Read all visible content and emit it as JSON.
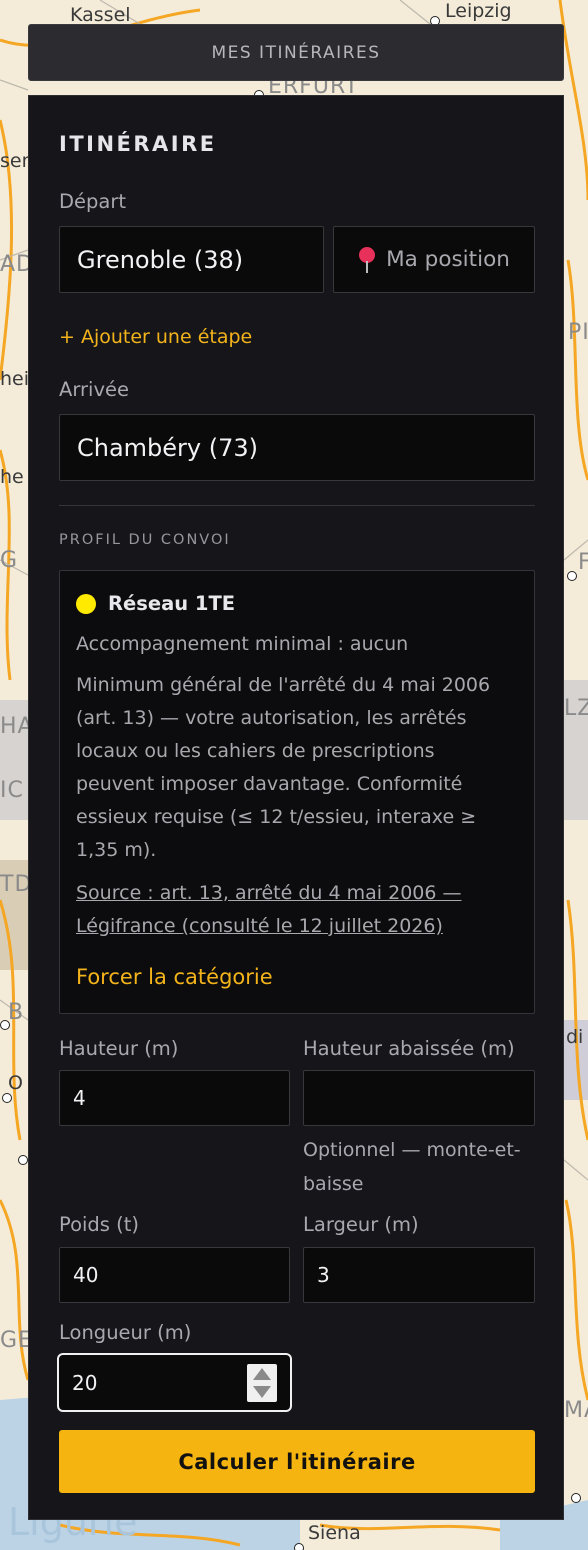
{
  "map": {
    "labels": {
      "kassel": "Kassel",
      "leipzig": "Leipzig",
      "erfurt": "ERFURT",
      "sen": "sen",
      "adi": "ADI",
      "pi": "PI",
      "hei": "hei",
      "he": "he",
      "g": "G",
      "f": "F",
      "ha": "HA",
      "lz": "LZ",
      "ic": "IC",
      "td": "TD",
      "b": "B",
      "di": "di",
      "o": "O",
      "ge": "GE",
      "ma": "MA",
      "ligurie": "Ligurie",
      "siena": "Siena"
    }
  },
  "topbar": {
    "label": "MES ITINÉRAIRES"
  },
  "panel": {
    "title": "ITINÉRAIRE",
    "depart": {
      "label": "Départ",
      "value": "Grenoble (38)"
    },
    "position_button": {
      "label": "Ma position",
      "icon": "map-pin-icon",
      "pin_color": "#e8315a"
    },
    "add_step": "+ Ajouter une étape",
    "arrivee": {
      "label": "Arrivée",
      "value": "Chambéry (73)"
    },
    "section_title": "PROFIL DU CONVOI",
    "network_card": {
      "dot_color": "#ffea00",
      "name": "Réseau 1TE",
      "escort": "Accompagnement minimal : aucun",
      "description": "Minimum général de l'arrêté du 4 mai 2006 (art. 13) — votre autorisation, les arrêtés locaux ou les cahiers de prescriptions peuvent imposer davantage. Conformité essieux requise (≤ 12 t/essieu, interaxe ≥ 1,35 m).",
      "source": "Source : art. 13, arrêté du 4 mai 2006 — Légifrance (consulté le 12 juillet 2026)",
      "force_link": "Forcer la catégorie"
    },
    "fields": {
      "hauteur": {
        "label": "Hauteur (m)",
        "value": "4"
      },
      "hauteur_abaissee": {
        "label": "Hauteur abaissée (m)",
        "value": "",
        "hint": "Optionnel — monte-et-baisse"
      },
      "poids": {
        "label": "Poids (t)",
        "value": "40"
      },
      "largeur": {
        "label": "Largeur (m)",
        "value": "3"
      },
      "longueur": {
        "label": "Longueur (m)",
        "value": "20"
      }
    },
    "calculate_button": "Calculer l'itinéraire",
    "accent_color": "#f5b40f"
  }
}
